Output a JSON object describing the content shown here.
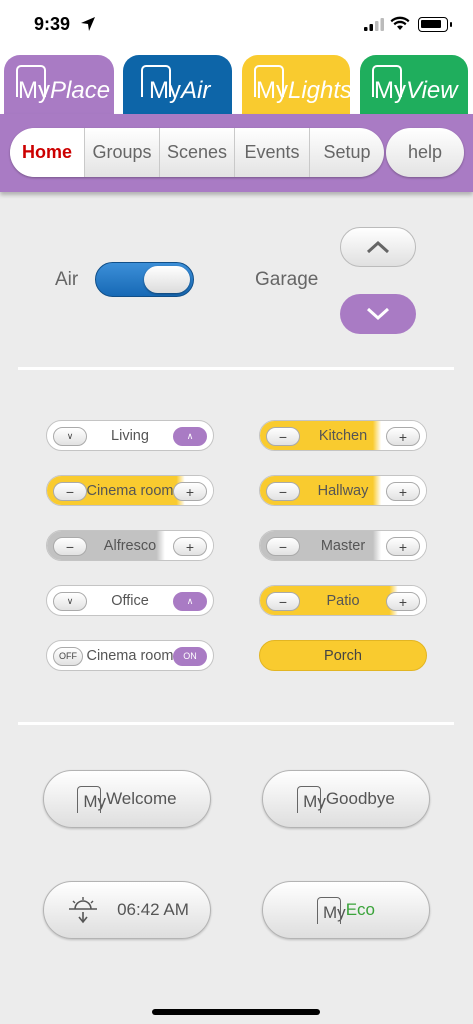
{
  "status_bar": {
    "time": "9:39"
  },
  "apps": [
    {
      "m": "My",
      "name": "Place",
      "color": "#a97bc4"
    },
    {
      "m": "My",
      "name": "Air",
      "color": "#0d65a8"
    },
    {
      "m": "My",
      "name": "Lights",
      "color": "#f9cb2f"
    },
    {
      "m": "My",
      "name": "View",
      "color": "#1fae5d"
    }
  ],
  "nav": {
    "tabs": [
      "Home",
      "Groups",
      "Scenes",
      "Events",
      "Setup"
    ],
    "active": "Home",
    "help": "help"
  },
  "controls": {
    "air_label": "Air",
    "air_on": true,
    "garage_label": "Garage"
  },
  "zones_left": [
    {
      "name": "Living",
      "kind": "blind",
      "left": "∨",
      "right": "∧"
    },
    {
      "name": "Cinema room",
      "kind": "dimmer",
      "level": 0.78,
      "left": "−",
      "right": "+"
    },
    {
      "name": "Alfresco",
      "kind": "dimmer-off",
      "level": 0.66,
      "left": "−",
      "right": "+"
    },
    {
      "name": "Office",
      "kind": "blind",
      "left": "∨",
      "right": "∧"
    },
    {
      "name": "Cinema room",
      "kind": "switch",
      "left": "OFF",
      "right": "ON"
    }
  ],
  "zones_right": [
    {
      "name": "Kitchen",
      "kind": "dimmer",
      "level": 0.68,
      "left": "−",
      "right": "+"
    },
    {
      "name": "Hallway",
      "kind": "dimmer",
      "level": 0.68,
      "left": "−",
      "right": "+"
    },
    {
      "name": "Master",
      "kind": "dimmer-off",
      "level": 0.68,
      "left": "−",
      "right": "+"
    },
    {
      "name": "Patio",
      "kind": "dimmer",
      "level": 0.78,
      "left": "−",
      "right": "+"
    },
    {
      "name": "Porch",
      "kind": "on"
    }
  ],
  "scenes": {
    "welcome": {
      "m": "My",
      "name": "Welcome"
    },
    "goodbye": {
      "m": "My",
      "name": "Goodbye"
    },
    "timer": "06:42 AM",
    "eco": {
      "m": "My",
      "name": "Eco"
    }
  }
}
